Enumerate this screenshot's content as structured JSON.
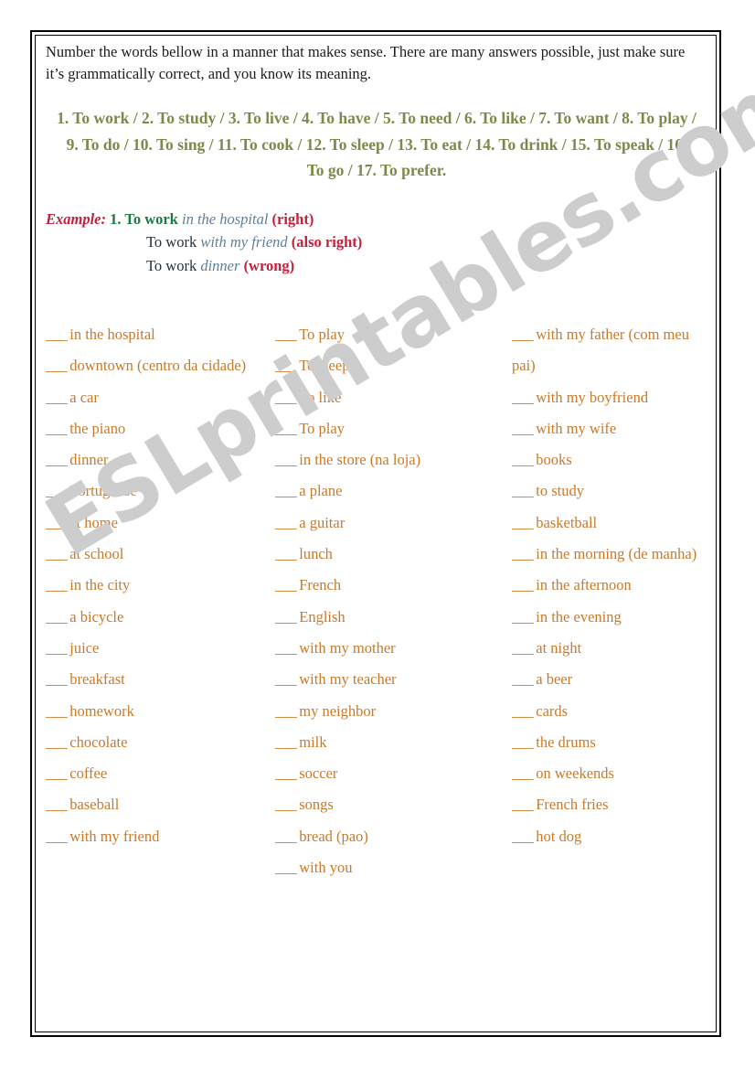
{
  "instructions": {
    "text": "Number the words bellow in a manner that makes sense. There are many answers possible, just make sure it’s grammatically correct, and you know its meaning."
  },
  "verb_list": {
    "text": "1.  To work  /  2. To study  /  3.  To live  /  4.  To have  /  5.  To need  /  6.  To like  /  7.  To want  /  8.  To play  /  9.  To do  /  10.  To sing  /  11.  To cook  /  12.  To sleep  /  13.  To eat  /  14.  To drink  /  15.  To speak  /  16.  To go  /  17. To prefer.",
    "verbs": [
      "1.  To work",
      "2. To study",
      "3.  To live",
      "4.  To have",
      "5.  To need",
      "6.  To like",
      "7.  To want",
      "8.  To play",
      "9.  To do",
      "10.  To sing",
      "11.  To cook",
      "12.  To sleep",
      "13.  To eat",
      "14.  To drink",
      "15.  To speak",
      "16.  To go",
      "17. To prefer."
    ]
  },
  "example": {
    "label": "Example:",
    "lines": [
      {
        "verb": "1. To work",
        "phrase": "in the hospital",
        "verdict": "(right)"
      },
      {
        "verb": "To work",
        "phrase": "with my friend",
        "verdict": "(also right)"
      },
      {
        "verb": "To work",
        "phrase": "dinner",
        "verdict": "(wrong)"
      }
    ]
  },
  "answer_columns": {
    "blank": "___",
    "column_1": [
      "in the hospital",
      "downtown (centro da cidade)",
      "a car",
      "the piano",
      "dinner",
      "Portuguese",
      "at home",
      "at school",
      "in the city",
      "a bicycle",
      "juice",
      "breakfast",
      "homework",
      "chocolate",
      "coffee",
      "baseball",
      "with my friend"
    ],
    "column_2": [
      "To play",
      "To sleep",
      "To like",
      "To play",
      "in the store (na loja)",
      "a plane",
      "a guitar",
      "lunch",
      "French",
      "English",
      "with my mother",
      "with my teacher",
      "my neighbor",
      "milk",
      "soccer",
      "songs",
      "bread (pao)",
      "with you"
    ],
    "column_3": [
      "with my father (com meu pai)",
      "with my boyfriend",
      "with my wife",
      "books",
      "to study",
      "basketball",
      "in the morning (de manha)",
      "in the afternoon",
      "in the evening",
      "at night",
      "a beer",
      "cards",
      "the drums",
      "on weekends",
      "French fries",
      "hot dog"
    ]
  },
  "watermark": {
    "text": "ESLprintables.com",
    "color": "#cdcdcd"
  },
  "colors": {
    "instructions": "#1b1b1b",
    "verb_list": "#7b8a4a",
    "example_label": "#c2213c",
    "example_verb": "#1b7a45",
    "example_phrase": "#5f7f99",
    "example_verdict": "#c2213c",
    "answer_items": "#c87a2b",
    "border": "#000000"
  }
}
